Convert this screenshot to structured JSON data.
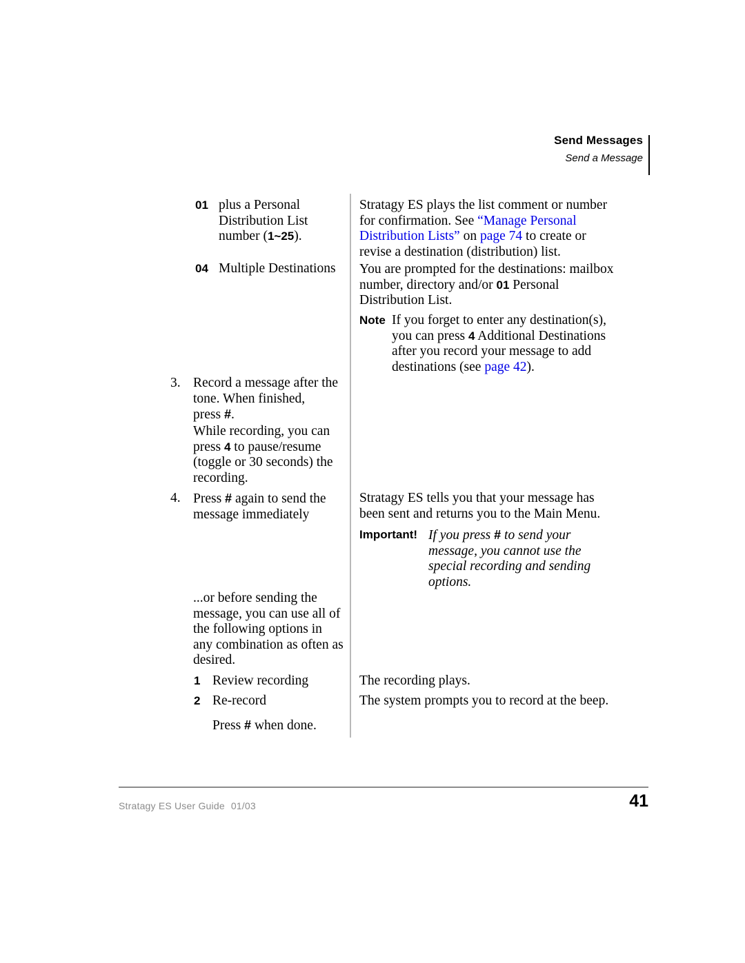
{
  "header": {
    "title": "Send Messages",
    "subtitle": "Send a Message"
  },
  "left_column": {
    "opt01": {
      "marker": "01",
      "line1": "plus a Personal",
      "line2": "Distribution List",
      "line3_pre": "number (",
      "line3_key": "1~25",
      "line3_post": ")."
    },
    "opt04": {
      "marker": "04",
      "text": "Multiple Destinations"
    },
    "step3": {
      "marker": "3.",
      "p1_a": "Record a message after the",
      "p1_b": "tone. When finished,",
      "p1_c_pre": "press ",
      "p1_c_key": "#",
      "p1_c_post": ".",
      "p2_a": "While recording, you can",
      "p2_b_pre": "press ",
      "p2_b_key": "4",
      "p2_b_post": " to pause/resume",
      "p2_c": "(toggle or 30 seconds) the",
      "p2_d": "recording."
    },
    "step4": {
      "marker": "4.",
      "pre": "Press ",
      "key": "#",
      "post": " again to send the",
      "line2": "message immediately"
    },
    "options_intro": {
      "line1": "...or before sending the",
      "line2": "message, you can use all of",
      "line3": "the following options in",
      "line4": "any combination as often as",
      "line5": "desired."
    },
    "opt1": {
      "marker": "1",
      "text": "Review recording"
    },
    "opt2": {
      "marker": "2",
      "text": "Re-record"
    },
    "press_done": {
      "pre": "Press ",
      "key": "#",
      "post": " when done."
    }
  },
  "right_column": {
    "resp01": {
      "line1": "Stratagy ES plays the list comment or number",
      "line2_pre": "for confirmation. See ",
      "line2_link": "“Manage Personal",
      "line3_link": "Distribution Lists”",
      "line3_mid": " on ",
      "line3_page": "page 74",
      "line3_post": " to create or",
      "line4": "revise a destination (distribution) list."
    },
    "resp04": {
      "line1": "You are prompted for the destinations: mailbox",
      "line2_pre": "number, directory and/or ",
      "line2_key": "01",
      "line2_post": " Personal",
      "line3": "Distribution List."
    },
    "note": {
      "label": "Note",
      "line1": "If you forget to enter any destination(s),",
      "line2_pre": "you can press ",
      "line2_key": "4",
      "line2_post": " Additional Destinations",
      "line3": "after you record your message to add",
      "line4_pre": "destinations (see ",
      "line4_page": "page 42",
      "line4_post": ")."
    },
    "resp4": {
      "line1": "Stratagy ES tells you that your message has",
      "line2": "been sent and returns you to the Main Menu."
    },
    "important": {
      "label": "Important!",
      "line1_pre": "If you press ",
      "line1_key": "#",
      "line1_post": " to send your",
      "line2": "message, you cannot use the",
      "line3": "special recording and sending",
      "line4": "options."
    },
    "resp1": "The recording plays.",
    "resp2": "The system prompts you to record at the beep."
  },
  "footer": {
    "guide": "Stratagy ES User Guide",
    "date": "01/03",
    "page_number": "41"
  }
}
